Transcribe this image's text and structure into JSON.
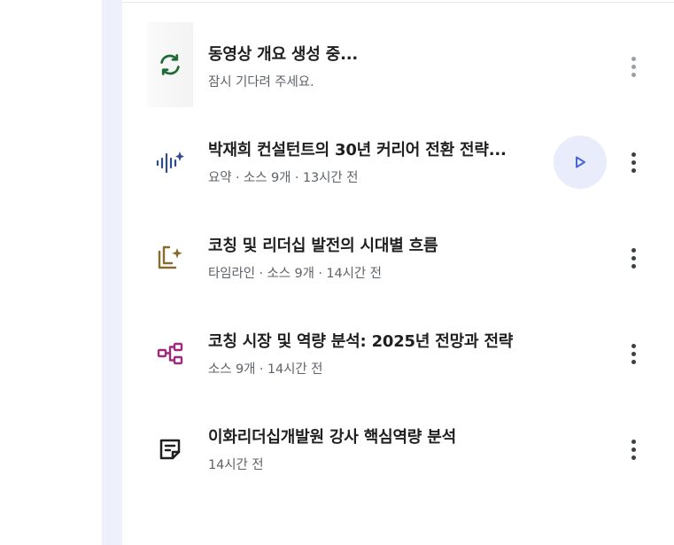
{
  "colors": {
    "rail": "#eef1fb",
    "loading_icon": "#1e6b36",
    "audio_icon": "#2f4b8f",
    "timeline_icon": "#8a6a2e",
    "mindmap_icon": "#9c2a7e",
    "note_icon": "#1f1f1f",
    "play_icon": "#4a66d8",
    "play_bg": "#e8ecfb"
  },
  "items": [
    {
      "icon": "refresh-icon",
      "title": "동영상 개요 생성 중...",
      "meta": "잠시 기다려 주세요.",
      "state": "generating"
    },
    {
      "icon": "audio-overview-icon",
      "title": "박재희 컨설턴트의 30년 커리어 전환 전략...",
      "meta": "요약 · 소스 9개 · 13시간 전",
      "has_play": true
    },
    {
      "icon": "timeline-icon",
      "title": "코칭 및 리더십 발전의 시대별 흐름",
      "meta": "타임라인 · 소스 9개 · 14시간 전"
    },
    {
      "icon": "mindmap-icon",
      "title": "코칭 시장 및 역량 분석: 2025년 전망과 전략",
      "meta": "소스 9개 · 14시간 전"
    },
    {
      "icon": "note-icon",
      "title": "이화리더십개발원 강사 핵심역량 분석",
      "meta": "14시간 전"
    }
  ]
}
